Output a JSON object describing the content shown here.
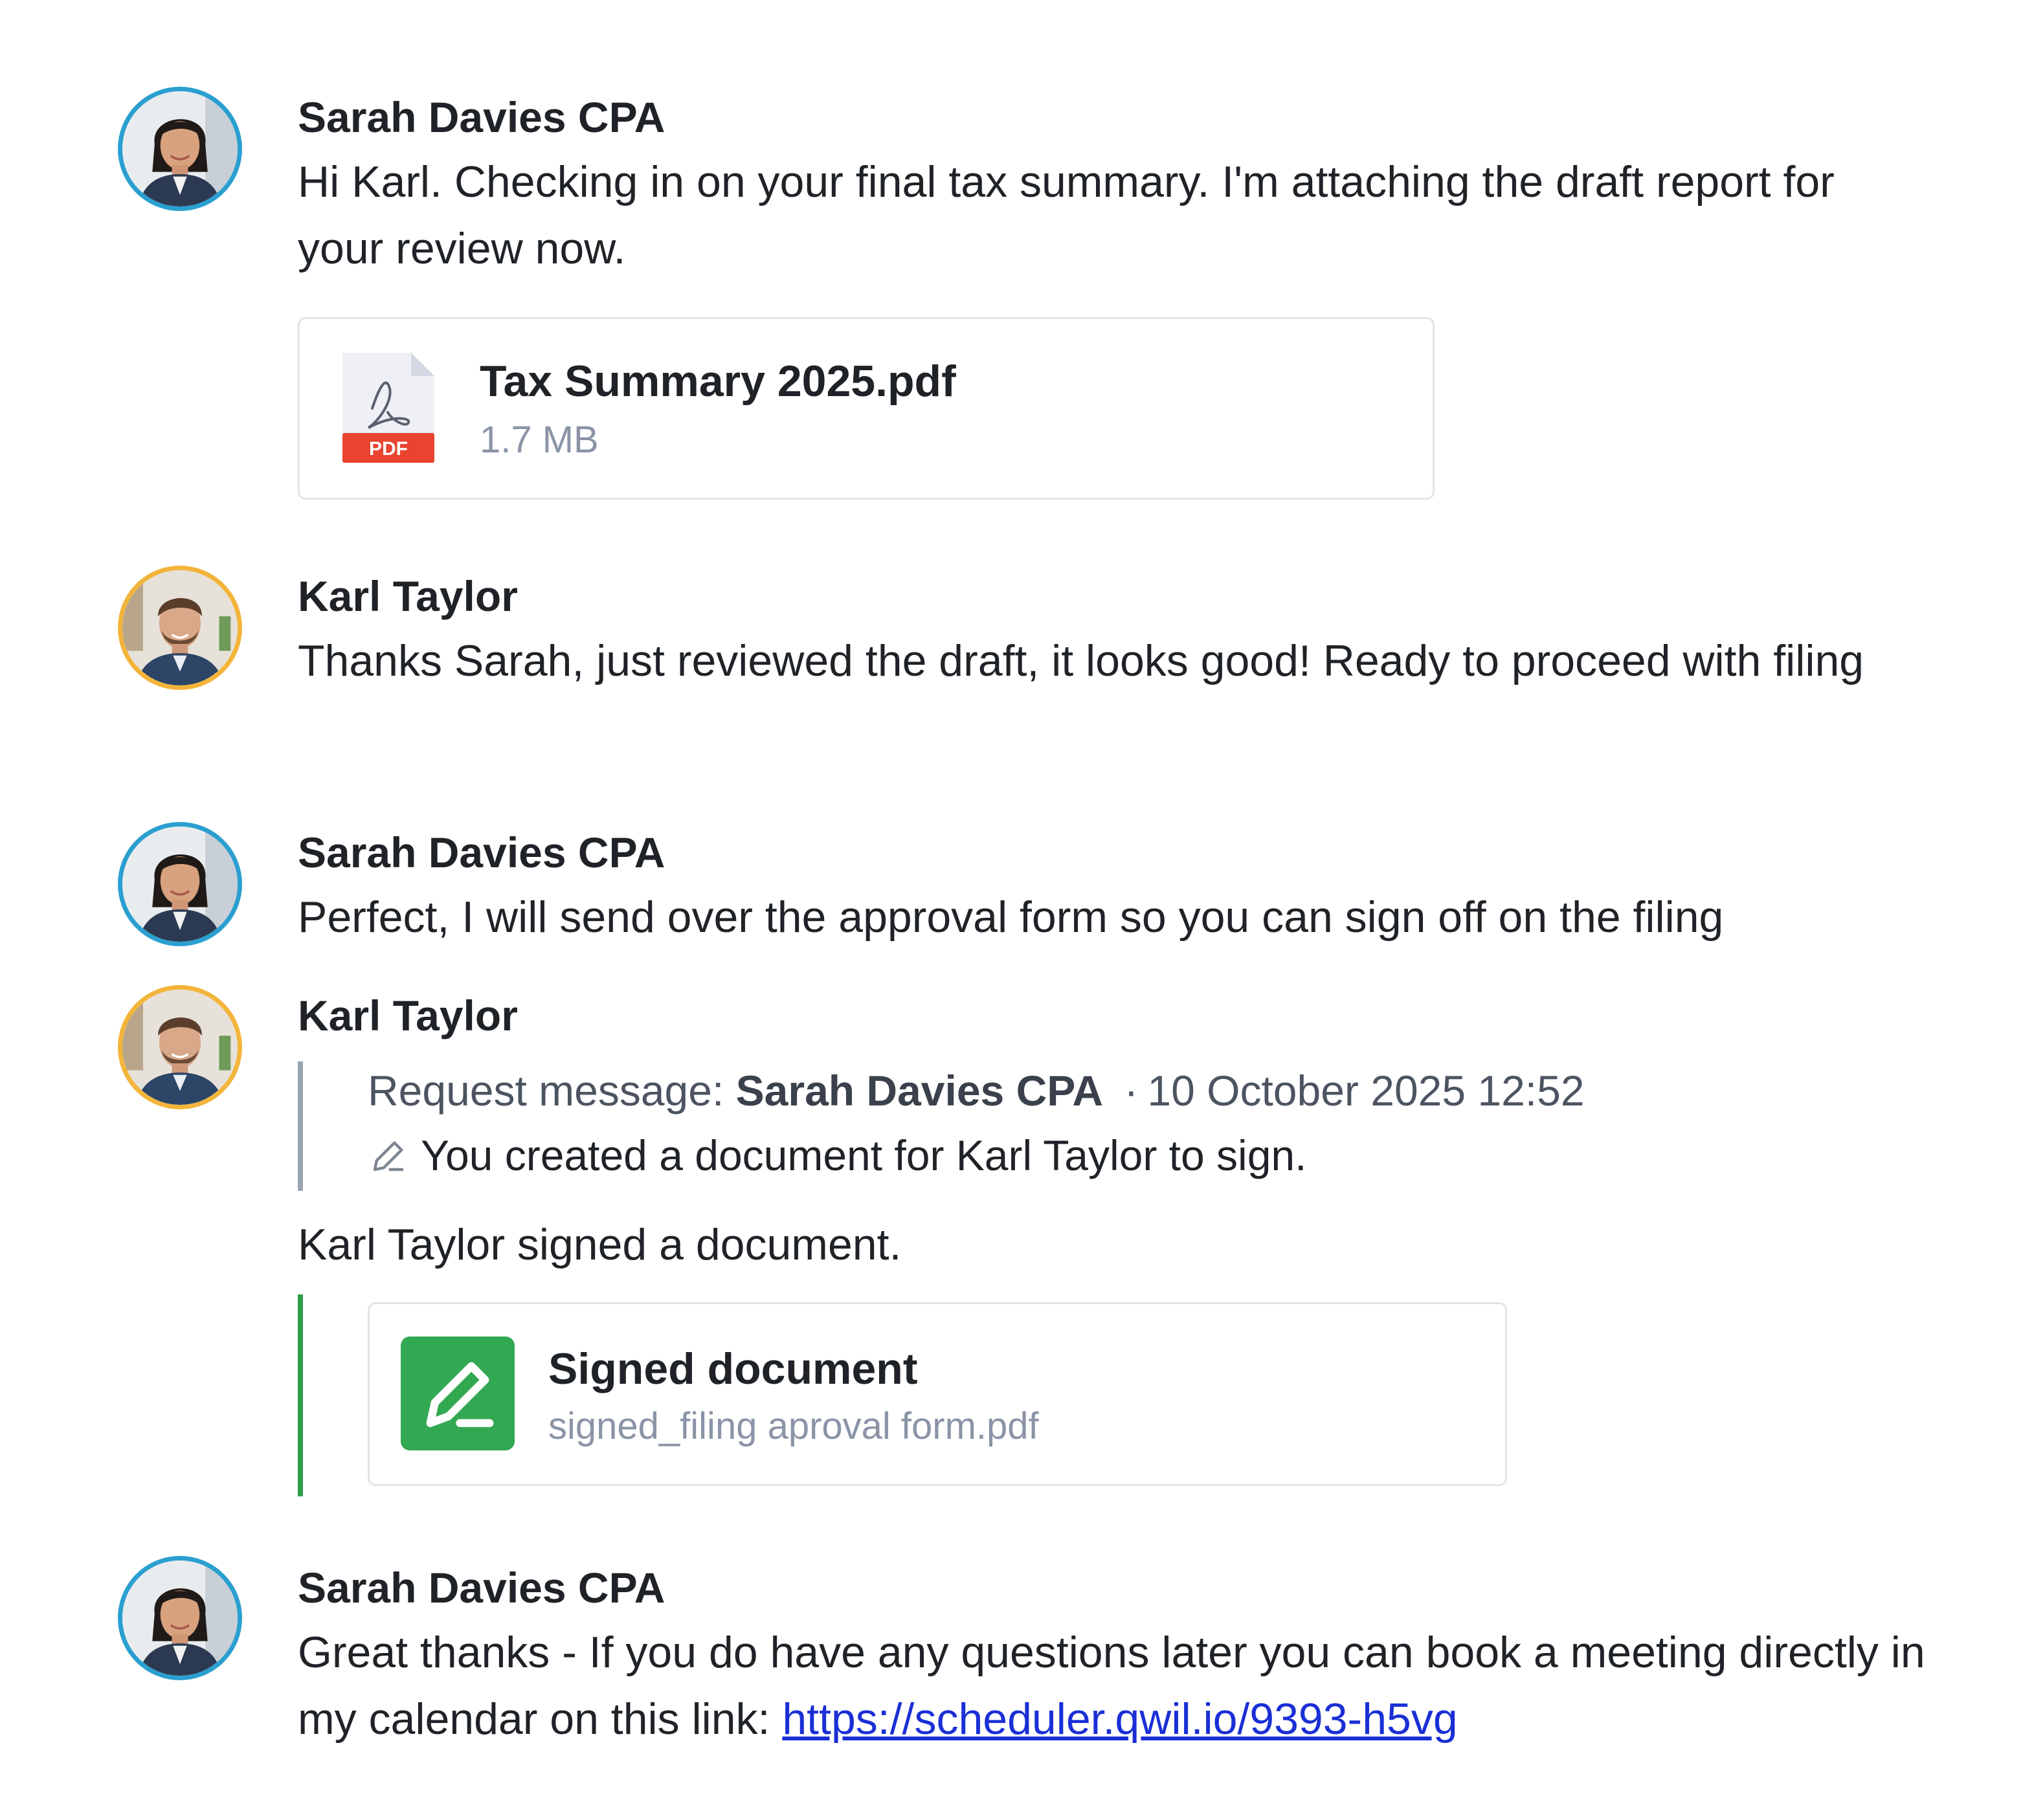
{
  "messages": [
    {
      "sender": "Sarah Davies CPA",
      "text": "Hi Karl. Checking in on your final tax summary. I'm attaching the draft report for your review now.",
      "attachment": {
        "name": "Tax Summary 2025.pdf",
        "size": "1.7 MB",
        "badge": "PDF",
        "icon": "pdf-file-icon"
      }
    },
    {
      "sender": "Karl Taylor",
      "text": "Thanks Sarah, just reviewed the draft, it looks good! Ready to proceed with filing"
    },
    {
      "sender": "Sarah Davies CPA",
      "text": "Perfect, I will send over the approval form so you can sign off on the filing"
    },
    {
      "sender": "Karl Taylor",
      "request": {
        "prefix": "Request message:",
        "author": "Sarah Davies CPA",
        "separator": "·",
        "timestamp": "10 October 2025 12:52",
        "text": "You created a document for Karl Taylor to sign.",
        "icon": "pencil-icon"
      },
      "text": "Karl Taylor signed a document.",
      "signed": {
        "title": "Signed document",
        "file": "signed_filing aproval form.pdf",
        "icon": "signature-icon"
      }
    },
    {
      "sender": "Sarah Davies CPA",
      "text_before_link": "Great thanks - If you do have any questions later you can book a meeting directly in my calendar on this link: ",
      "link": "https://scheduler.qwil.io/9393-h5vg"
    }
  ],
  "colors": {
    "sarah_ring": "#2a9fd0",
    "karl_ring": "#f3b43a",
    "quote_bar": "#9aa3b2",
    "signed_bar": "#2e9e48",
    "signed_icon_bg": "#33a852",
    "pdf_badge": "#e8442f",
    "link": "#1a2fd6",
    "muted_text": "#8a94a6"
  }
}
